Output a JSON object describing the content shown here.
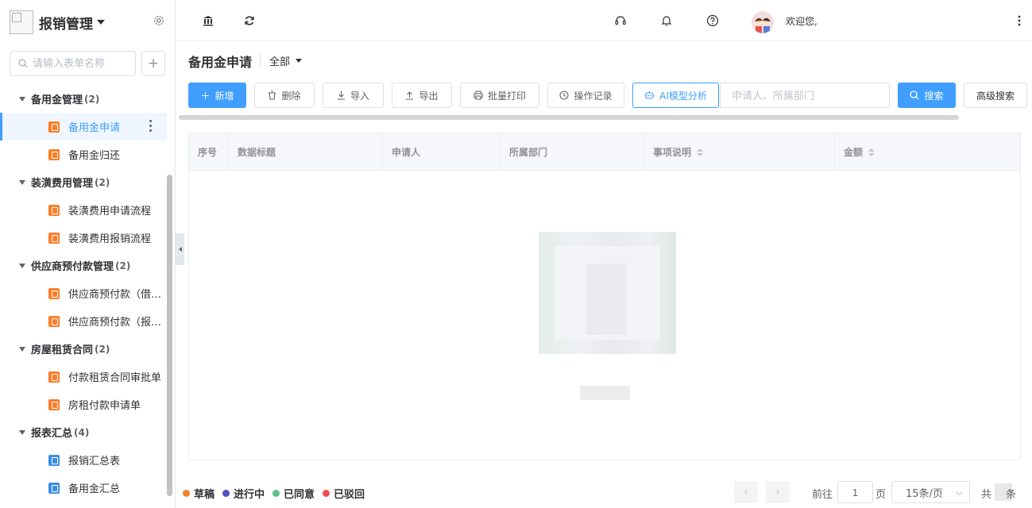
{
  "sidebar": {
    "app_title": "报销管理",
    "search_placeholder": "请输入表单名称",
    "add_label": "+",
    "groups": [
      {
        "label": "备用金管理",
        "count": "(2)",
        "items": [
          {
            "label": "备用金申请",
            "icon": "orange",
            "active": true
          },
          {
            "label": "备用金归还",
            "icon": "orange"
          }
        ]
      },
      {
        "label": "装潢费用管理",
        "count": "(2)",
        "items": [
          {
            "label": "装潢费用申请流程",
            "icon": "orange"
          },
          {
            "label": "装潢费用报销流程",
            "icon": "orange"
          }
        ]
      },
      {
        "label": "供应商预付款管理",
        "count": "(2)",
        "items": [
          {
            "label": "供应商预付款（借…",
            "icon": "orange"
          },
          {
            "label": "供应商预付款（报…",
            "icon": "orange"
          }
        ]
      },
      {
        "label": "房屋租赁合同",
        "count": "(2)",
        "items": [
          {
            "label": "付款租赁合同审批单",
            "icon": "orange"
          },
          {
            "label": "房租付款申请单",
            "icon": "orange"
          }
        ]
      },
      {
        "label": "报表汇总",
        "count": "(4)",
        "items": [
          {
            "label": "报销汇总表",
            "icon": "blue"
          },
          {
            "label": "备用金汇总",
            "icon": "blue"
          }
        ]
      }
    ]
  },
  "topbar": {
    "welcome": "欢迎您,",
    "icons": [
      "bank-icon",
      "refresh-icon",
      "headset-icon",
      "bell-icon",
      "help-icon",
      "more-vertical-icon"
    ]
  },
  "page": {
    "title": "备用金申请",
    "filter": "全部"
  },
  "toolbar": {
    "new": "新增",
    "delete": "删除",
    "import": "导入",
    "export": "导出",
    "batch_print": "批量打印",
    "op_log": "操作记录",
    "ai": "AI模型分析",
    "keyword_placeholder": "申请人、所属部门",
    "search": "搜索",
    "advanced": "高级搜索"
  },
  "table": {
    "columns": [
      "序号",
      "数据标题",
      "申请人",
      "所属部门",
      "事项说明",
      "金额"
    ]
  },
  "legend": [
    {
      "label": "草稿",
      "color": "#f5822a"
    },
    {
      "label": "进行中",
      "color": "#5051c4"
    },
    {
      "label": "已同意",
      "color": "#5bc48a"
    },
    {
      "label": "已驳回",
      "color": "#f24e55"
    }
  ],
  "pagination": {
    "goto": "前往",
    "page": "1",
    "page_unit": "页",
    "page_size": "15条/页",
    "total_prefix": "共",
    "total_suffix": "条"
  }
}
